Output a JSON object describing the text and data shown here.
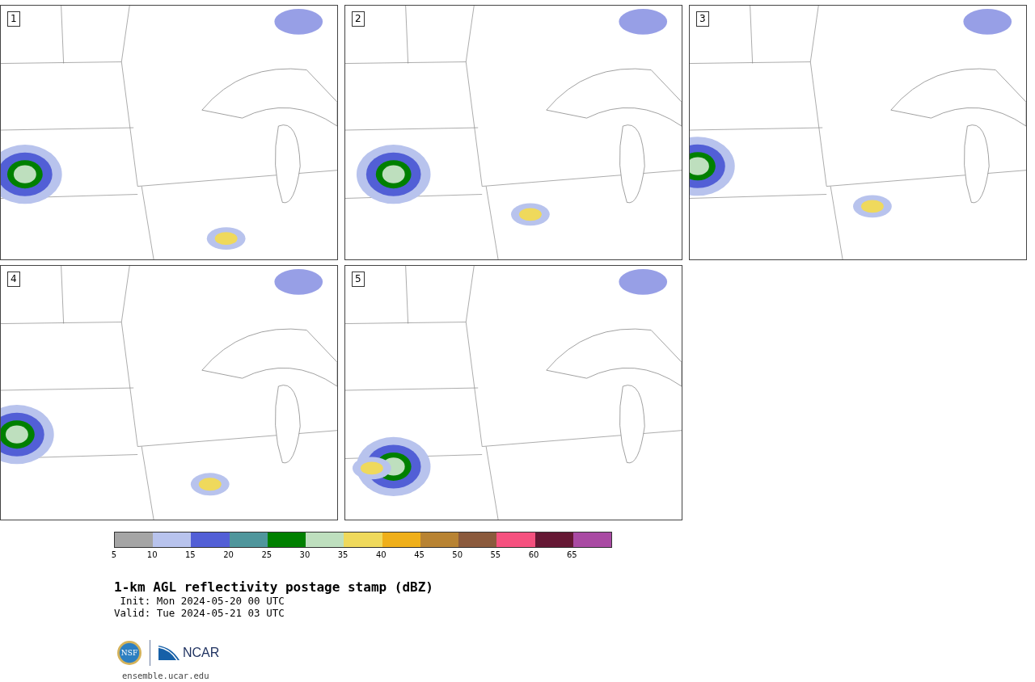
{
  "panels": [
    {
      "label": "1"
    },
    {
      "label": "2"
    },
    {
      "label": "3"
    },
    {
      "label": "4"
    },
    {
      "label": "5"
    }
  ],
  "colorbar": {
    "segments": [
      {
        "color": "#a5a5a5"
      },
      {
        "color": "#b8c3ed"
      },
      {
        "color": "#525fd6"
      },
      {
        "color": "#4f969c"
      },
      {
        "color": "#008000"
      },
      {
        "color": "#bedfbe"
      },
      {
        "color": "#efd95c"
      },
      {
        "color": "#efaf1a"
      },
      {
        "color": "#b88333"
      },
      {
        "color": "#8b5a3d"
      },
      {
        "color": "#f5517f"
      },
      {
        "color": "#651834"
      },
      {
        "color": "#a94aa3"
      }
    ],
    "ticks": [
      "5",
      "10",
      "15",
      "20",
      "25",
      "30",
      "35",
      "40",
      "45",
      "50",
      "55",
      "60",
      "65"
    ]
  },
  "title": "1-km AGL reflectivity postage stamp (dBZ)",
  "init": " Init: Mon 2024-05-20 00 UTC",
  "valid": "Valid: Tue 2024-05-21 03 UTC",
  "logos": {
    "seal_text": "NSF",
    "ncar_text": "NCAR"
  },
  "footer": "ensemble.ucar.edu"
}
